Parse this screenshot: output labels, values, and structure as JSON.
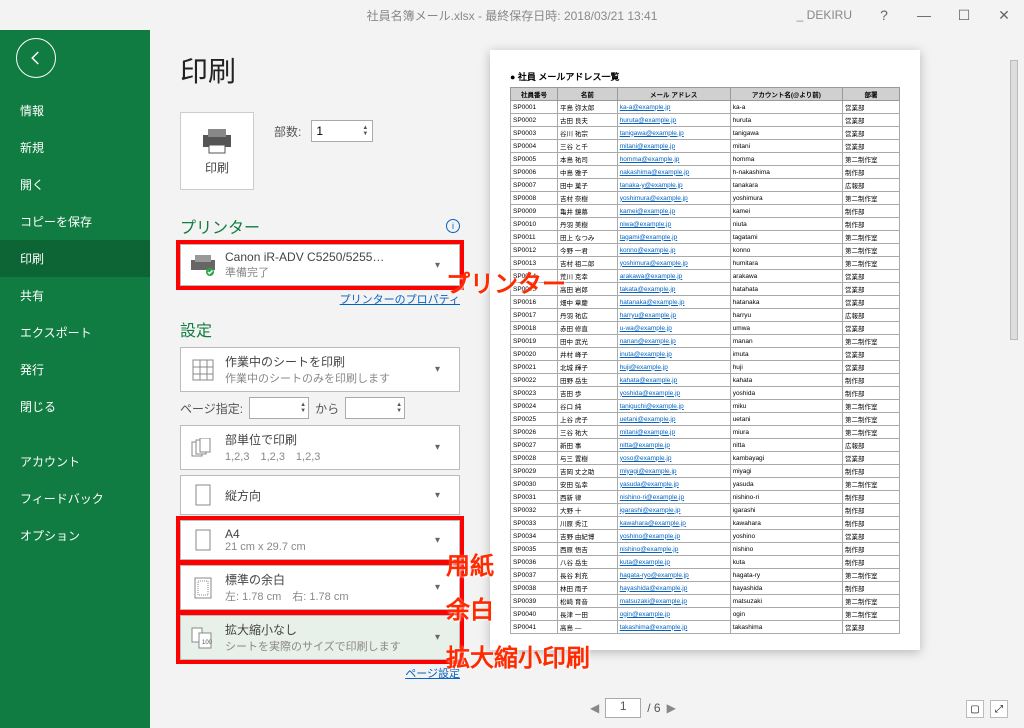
{
  "titlebar": {
    "title": "社員名簿メール.xlsx - 最終保存日時: 2018/03/21 13:41",
    "user": "_ DEKIRU",
    "help": "?",
    "min": "—",
    "max": "☐",
    "close": "✕"
  },
  "nav": {
    "items": [
      "情報",
      "新規",
      "開く",
      "コピーを保存",
      "印刷",
      "共有",
      "エクスポート",
      "発行",
      "閉じる"
    ],
    "items2": [
      "アカウント",
      "フィードバック",
      "オプション"
    ]
  },
  "print": {
    "title": "印刷",
    "btn_label": "印刷",
    "copies_label": "部数:",
    "copies_value": "1"
  },
  "printer": {
    "section": "プリンター",
    "name": "Canon iR-ADV C5250/5255…",
    "status": "準備完了",
    "properties": "プリンターのプロパティ"
  },
  "settings": {
    "section": "設定",
    "sheet_title": "作業中のシートを印刷",
    "sheet_sub": "作業中のシートのみを印刷します",
    "page_label": "ページ指定:",
    "page_to": "から",
    "collate_title": "部単位で印刷",
    "collate_sub": "1,2,3　1,2,3　1,2,3",
    "orient": "縦方向",
    "paper_title": "A4",
    "paper_sub": "21 cm x 29.7 cm",
    "margin_title": "標準の余白",
    "margin_sub": "左: 1.78 cm　右: 1.78 cm",
    "scale_title": "拡大縮小なし",
    "scale_sub": "シートを実際のサイズで印刷します",
    "page_setup": "ページ設定"
  },
  "pager": {
    "prev": "◀",
    "current": "1",
    "sep": "/ 6",
    "next": "▶"
  },
  "annotations": {
    "printer": "プリンター",
    "paper": "用紙",
    "margin": "余白",
    "scale": "拡大縮小印刷"
  },
  "preview": {
    "title": "● 社員 メールアドレス一覧",
    "headers": [
      "社員番号",
      "名前",
      "メール アドレス",
      "アカウント名(@より前)",
      "部署"
    ],
    "rows": [
      [
        "SP0001",
        "平島 弥太郎",
        "ka-a@example.jp",
        "ka-a",
        "営業部"
      ],
      [
        "SP0002",
        "古田 良夫",
        "huruta@example.jp",
        "huruta",
        "営業部"
      ],
      [
        "SP0003",
        "谷川 祐宗",
        "tanigawa@example.jp",
        "tanigawa",
        "営業部"
      ],
      [
        "SP0004",
        "三谷 と千",
        "mitani@example.jp",
        "mitani",
        "営業部"
      ],
      [
        "SP0005",
        "本島 祐司",
        "homma@example.jp",
        "homma",
        "第二制作室"
      ],
      [
        "SP0006",
        "中島 雅子",
        "nakashima@example.jp",
        "h-nakashima",
        "制作部"
      ],
      [
        "SP0007",
        "田中 菓子",
        "tanaka-y@example.jp",
        "tanakara",
        "広報部"
      ],
      [
        "SP0008",
        "吉村 奈樹",
        "yoshimura@example.jp",
        "yoshimura",
        "第二制作室"
      ],
      [
        "SP0009",
        "亀井 鏡慕",
        "kamei@example.jp",
        "kamei",
        "制作部"
      ],
      [
        "SP0010",
        "丹羽 美樹",
        "niwa@example.jp",
        "niuta",
        "制作部"
      ],
      [
        "SP0011",
        "田上 なつみ",
        "tagami@example.jp",
        "tagatami",
        "第二制作室"
      ],
      [
        "SP0012",
        "今野 一君",
        "konno@example.jp",
        "konno",
        "第二制作室"
      ],
      [
        "SP0013",
        "吉村 祖二郎",
        "yoshimura@example.jp",
        "humitara",
        "第二制作室"
      ],
      [
        "SP0014",
        "荒川 克幸",
        "arakawa@example.jp",
        "arakawa",
        "営業部"
      ],
      [
        "SP0015",
        "高田 岩郎",
        "takata@example.jp",
        "hatahata",
        "営業部"
      ],
      [
        "SP0016",
        "畑中 章慶",
        "hatanaka@example.jp",
        "hatanaka",
        "営業部"
      ],
      [
        "SP0017",
        "丹羽 祐広",
        "harryu@example.jp",
        "harryu",
        "広報部"
      ],
      [
        "SP0018",
        "赤田 修直",
        "u-wa@example.jp",
        "umwa",
        "営業部"
      ],
      [
        "SP0019",
        "田中 武光",
        "nanan@example.jp",
        "manan",
        "第二制作室"
      ],
      [
        "SP0020",
        "井村 峰子",
        "inuta@example.jp",
        "imuta",
        "営業部"
      ],
      [
        "SP0021",
        "北城 輝子",
        "huji@example.jp",
        "huji",
        "営業部"
      ],
      [
        "SP0022",
        "田野 岳生",
        "kahata@example.jp",
        "kahata",
        "制作部"
      ],
      [
        "SP0023",
        "吉田 歩",
        "yoshida@example.jp",
        "yoshida",
        "制作部"
      ],
      [
        "SP0024",
        "谷口 純",
        "taniguchi@example.jp",
        "miku",
        "第二制作室"
      ],
      [
        "SP0025",
        "上谷 虎子",
        "uetani@example.jp",
        "uetani",
        "第二制作室"
      ],
      [
        "SP0026",
        "三谷 祐大",
        "mitani@example.jp",
        "miura",
        "第二制作室"
      ],
      [
        "SP0027",
        "新田 事",
        "nitta@example.jp",
        "nitta",
        "広報部"
      ],
      [
        "SP0028",
        "与三 置樹",
        "yoso@example.jp",
        "kambayagi",
        "営業部"
      ],
      [
        "SP0029",
        "吉岡 丈之助",
        "miyagi@example.jp",
        "miyagi",
        "制作部"
      ],
      [
        "SP0030",
        "安田 弘幸",
        "yasuda@example.jp",
        "yasuda",
        "第二制作室"
      ],
      [
        "SP0031",
        "西新 律",
        "nishino-ri@example.jp",
        "nishino-ri",
        "制作部"
      ],
      [
        "SP0032",
        "大野 十",
        "igarashi@example.jp",
        "igarashi",
        "制作部"
      ],
      [
        "SP0033",
        "川原 秀江",
        "kawahara@example.jp",
        "kawahara",
        "制作部"
      ],
      [
        "SP0034",
        "吉野 由紀博",
        "yoshino@example.jp",
        "yoshino",
        "営業部"
      ],
      [
        "SP0035",
        "西原 悟吉",
        "nishino@example.jp",
        "nishino",
        "制作部"
      ],
      [
        "SP0036",
        "八谷 岳生",
        "kuta@example.jp",
        "kuta",
        "制作部"
      ],
      [
        "SP0037",
        "長谷 利充",
        "hagata-ryo@example.jp",
        "hagata-ry",
        "第二制作室"
      ],
      [
        "SP0038",
        "林田 雨子",
        "hayashida@example.jp",
        "hayashida",
        "制作部"
      ],
      [
        "SP0039",
        "松崎 育音",
        "matsuzaki@example.jp",
        "matsuzaki",
        "第二制作室"
      ],
      [
        "SP0040",
        "長津 一田",
        "ogin@example.jp",
        "ogin",
        "第二制作室"
      ],
      [
        "SP0041",
        "高島 ―",
        "takashima@example.jp",
        "takashima",
        "営業部"
      ]
    ]
  }
}
